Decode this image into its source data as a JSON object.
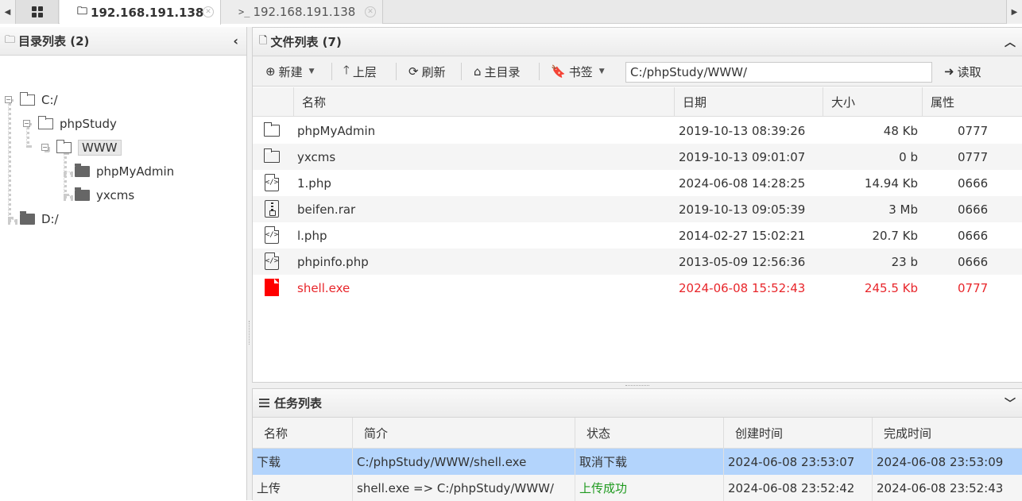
{
  "tabs": [
    {
      "label": "192.168.191.138",
      "icon": "folder-outline-icon",
      "active": true
    },
    {
      "label": "192.168.191.138",
      "icon": "terminal-icon",
      "active": false
    }
  ],
  "left_panel": {
    "title": "目录列表 (2)",
    "tree": {
      "c_drive": "C:/",
      "phpstudy": "phpStudy",
      "www": "WWW",
      "phpmyadmin": "phpMyAdmin",
      "yxcms": "yxcms",
      "d_drive": "D:/"
    }
  },
  "file_panel": {
    "title": "文件列表 (7)",
    "toolbar": {
      "new": "新建",
      "up": "上层",
      "refresh": "刷新",
      "home": "主目录",
      "bookmark": "书签",
      "path": "C:/phpStudy/WWW/",
      "read": "读取"
    },
    "columns": {
      "name": "名称",
      "date": "日期",
      "size": "大小",
      "attr": "属性"
    },
    "files": [
      {
        "name": "phpMyAdmin",
        "date": "2019-10-13 08:39:26",
        "size": "48 Kb",
        "attr": "0777",
        "icon": "folder-icon"
      },
      {
        "name": "yxcms",
        "date": "2019-10-13 09:01:07",
        "size": "0 b",
        "attr": "0777",
        "icon": "folder-icon"
      },
      {
        "name": "1.php",
        "date": "2024-06-08 14:28:25",
        "size": "14.94 Kb",
        "attr": "0666",
        "icon": "code-file-icon"
      },
      {
        "name": "beifen.rar",
        "date": "2019-10-13 09:05:39",
        "size": "3 Mb",
        "attr": "0666",
        "icon": "archive-file-icon"
      },
      {
        "name": "l.php",
        "date": "2014-02-27 15:02:21",
        "size": "20.7 Kb",
        "attr": "0666",
        "icon": "code-file-icon"
      },
      {
        "name": "phpinfo.php",
        "date": "2013-05-09 12:56:36",
        "size": "23 b",
        "attr": "0666",
        "icon": "code-file-icon"
      },
      {
        "name": "shell.exe",
        "date": "2024-06-08 15:52:43",
        "size": "245.5 Kb",
        "attr": "0777",
        "icon": "file-icon",
        "color": "#e8262b"
      }
    ]
  },
  "task_panel": {
    "title": "任务列表",
    "columns": {
      "name": "名称",
      "desc": "简介",
      "status": "状态",
      "created": "创建时间",
      "finished": "完成时间"
    },
    "tasks": [
      {
        "name": "下载",
        "desc": "C:/phpStudy/WWW/shell.exe",
        "status": "取消下载",
        "created": "2024-06-08 23:53:07",
        "finished": "2024-06-08 23:53:09"
      },
      {
        "name": "上传",
        "desc": "shell.exe => C:/phpStudy/WWW/",
        "status": "上传成功",
        "created": "2024-06-08 23:52:42",
        "finished": "2024-06-08 23:52:43"
      }
    ]
  },
  "colors": {
    "danger": "#e8262b",
    "success": "#1f9a1f",
    "selected_row": "#b3d4fc"
  }
}
